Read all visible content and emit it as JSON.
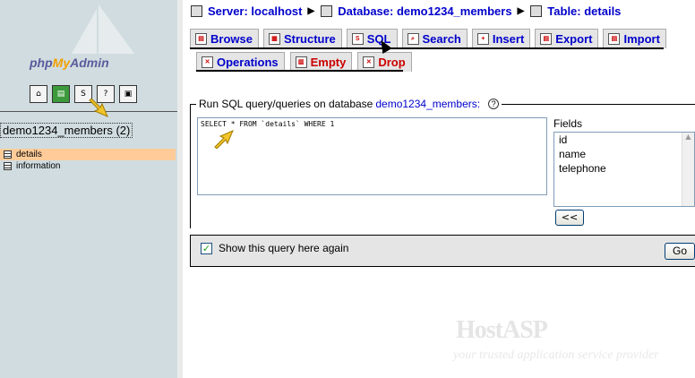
{
  "left": {
    "logo": {
      "php": "php",
      "my": "My",
      "admin": "Admin"
    },
    "icons": [
      "home-icon",
      "sql-query-icon",
      "sql-icon",
      "query-window-icon",
      "documentation-icon"
    ],
    "db_name": "demo1234_members (2)",
    "tables": [
      {
        "label": "details"
      },
      {
        "label": "information"
      }
    ]
  },
  "breadcrumb": {
    "server": "Server: localhost",
    "database": "Database: demo1234_members",
    "table": "Table: details"
  },
  "tabs": {
    "browse": "Browse",
    "structure": "Structure",
    "sql": "SQL",
    "search": "Search",
    "insert": "Insert",
    "export": "Export",
    "import": "Import",
    "operations": "Operations",
    "empty": "Empty",
    "drop": "Drop"
  },
  "sql_panel": {
    "legend_text": "Run SQL query/queries on database",
    "legend_db": "demo1234_members:",
    "query": "SELECT * FROM `details` WHERE 1",
    "fields_label": "Fields",
    "fields": [
      "id",
      "name",
      "telephone"
    ],
    "insert_button": "<<",
    "show_again_label": "Show this query here again",
    "show_again_checked": true,
    "go_button": "Go"
  },
  "watermark": {
    "brand_host": "Host",
    "brand_asp": "ASP",
    "tagline": "your trusted application service provider"
  }
}
